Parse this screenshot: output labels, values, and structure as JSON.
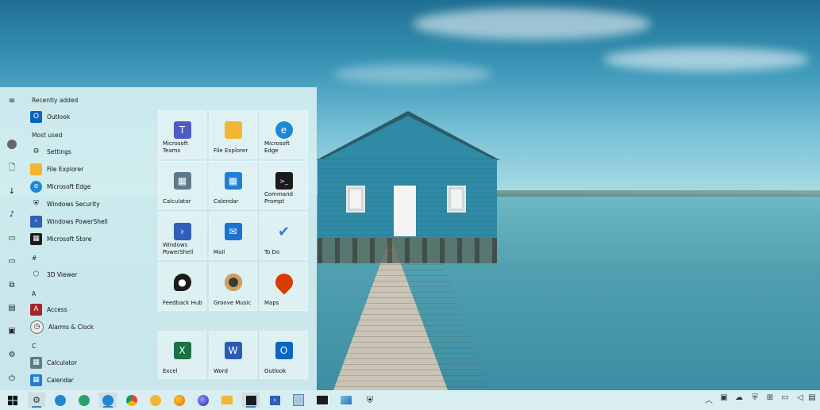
{
  "start_menu": {
    "sections": {
      "recently_added": "Recently added",
      "most_used": "Most used",
      "hash": "#",
      "a": "A",
      "c": "C"
    },
    "recent": [
      {
        "label": "Outlook",
        "icon": "outlook-icon",
        "color": "#0a66c2"
      }
    ],
    "most_used": [
      {
        "label": "Settings",
        "icon": "gear-icon",
        "color": "#444444"
      },
      {
        "label": "File Explorer",
        "icon": "folder-icon",
        "color": "#f2b632"
      },
      {
        "label": "Microsoft Edge",
        "icon": "edge-icon",
        "color": "#1d88d3"
      },
      {
        "label": "Windows Security",
        "icon": "shield-icon",
        "color": "#111111"
      },
      {
        "label": "Windows PowerShell",
        "icon": "powershell-icon",
        "color": "#2f5fb6"
      },
      {
        "label": "Microsoft Store",
        "icon": "store-icon",
        "color": "#1b1b1b"
      }
    ],
    "hash_apps": [
      {
        "label": "3D Viewer",
        "icon": "cube-icon",
        "color": "#555555"
      }
    ],
    "a_apps": [
      {
        "label": "Access",
        "icon": "access-icon",
        "color": "#a4262c"
      },
      {
        "label": "Alarms & Clock",
        "icon": "clock-icon",
        "color": "#555555"
      }
    ],
    "c_apps": [
      {
        "label": "Calculator",
        "icon": "calculator-icon",
        "color": "#4f6f7a"
      },
      {
        "label": "Calendar",
        "icon": "calendar-icon",
        "color": "#1f7ed6"
      }
    ],
    "tiles": [
      {
        "label": "Microsoft\nTeams",
        "icon": "teams-icon",
        "color": "#5059c9"
      },
      {
        "label": "File Explorer",
        "icon": "folder-icon",
        "color": "#f2b632"
      },
      {
        "label": "Microsoft Edge",
        "icon": "edge-icon",
        "color": "#1d88d3"
      },
      {
        "label": "Calculator",
        "icon": "calculator-icon",
        "color": "#5c7b86"
      },
      {
        "label": "Calendar",
        "icon": "calendar-icon",
        "color": "#1f7ed6"
      },
      {
        "label": "Command\nPrompt",
        "icon": "terminal-icon",
        "color": "#1b1b1b"
      },
      {
        "label": "Windows\nPowerShell",
        "icon": "powershell-icon",
        "color": "#2f5fb6"
      },
      {
        "label": "Mail",
        "icon": "mail-icon",
        "color": "#1a73d1"
      },
      {
        "label": "To Do",
        "icon": "check-icon",
        "color": "#2e7de2"
      },
      {
        "label": "Feedback Hub",
        "icon": "feedback-icon",
        "color": "#1b1b1b"
      },
      {
        "label": "Groove Music",
        "icon": "music-disc-icon",
        "color": "#3a3a3a"
      },
      {
        "label": "Maps",
        "icon": "map-pin-icon",
        "color": "#d83b01"
      },
      {
        "label": "Excel",
        "icon": "excel-icon",
        "color": "#1d7044"
      },
      {
        "label": "Word",
        "icon": "word-icon",
        "color": "#2b5bb5"
      },
      {
        "label": "Outlook",
        "icon": "outlook-icon",
        "color": "#0a66c2"
      }
    ]
  },
  "taskbar": {
    "apps": [
      {
        "icon": "settings-gear-icon",
        "color": "#333333"
      },
      {
        "icon": "edge-icon",
        "color": "#1d88d3"
      },
      {
        "icon": "edge-beta-icon",
        "color": "#2aa36b"
      },
      {
        "icon": "edge-dev-icon",
        "color": "#1d88d3"
      },
      {
        "icon": "chrome-icon",
        "color": "#db4437"
      },
      {
        "icon": "chrome-canary-icon",
        "color": "#f2b632"
      },
      {
        "icon": "firefox-icon",
        "color": "#e66000"
      },
      {
        "icon": "firefox-nightly-icon",
        "color": "#5b3fd1"
      },
      {
        "icon": "file-explorer-icon",
        "color": "#f2b632"
      },
      {
        "icon": "store-icon",
        "color": "#1b1b1b"
      },
      {
        "icon": "powershell-icon",
        "color": "#2f5fb6"
      },
      {
        "icon": "notepad-icon",
        "color": "#7aa7c7"
      },
      {
        "icon": "terminal-icon",
        "color": "#1b1b1b"
      },
      {
        "icon": "photos-icon",
        "color": "#1f6fb0"
      },
      {
        "icon": "shield-icon",
        "color": "#111111"
      }
    ],
    "tray": [
      {
        "icon": "chevron-up-icon",
        "glyph": "︿"
      },
      {
        "icon": "app-tray-icon",
        "glyph": "▣"
      },
      {
        "icon": "cloud-icon",
        "glyph": "☁"
      },
      {
        "icon": "security-tray-icon",
        "glyph": "⛨"
      },
      {
        "icon": "usb-icon",
        "glyph": "⊞"
      },
      {
        "icon": "network-icon",
        "glyph": "▭"
      },
      {
        "icon": "volume-icon",
        "glyph": "🔈"
      },
      {
        "icon": "notifications-icon",
        "glyph": "▤"
      }
    ]
  }
}
